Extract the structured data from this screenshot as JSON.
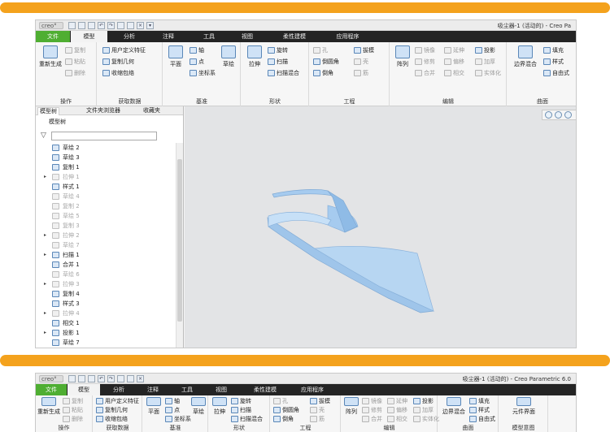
{
  "app": {
    "logo": "creo°",
    "window_title": "吸尘器-1 (活动的) - Creo Parametric 6.0",
    "window_title_truncated": "吸尘器-1 (活动的) - Creo Pa"
  },
  "tabs": [
    "文件",
    "模型",
    "分析",
    "注释",
    "工具",
    "视图",
    "柔性建模",
    "应用程序"
  ],
  "ribbon": {
    "operation": {
      "label": "操作",
      "regenerate": "重新生成",
      "copy": "复制",
      "paste": "粘贴",
      "delete": "删除"
    },
    "get_data": {
      "label": "获取数据",
      "user_feature": "用户定义特征",
      "copy_geometry": "复制几何",
      "shrinkwrap": "收缩包络"
    },
    "datum": {
      "label": "基准",
      "plane": "平面",
      "axis": "轴",
      "point": "点",
      "csys": "坐标系",
      "sketch": "草绘"
    },
    "shapes": {
      "label": "形状",
      "extrude": "拉伸",
      "revolve": "旋转",
      "sweep": "扫描",
      "swept_blend": "扫描混合"
    },
    "engineering": {
      "label": "工程",
      "hole": "孔",
      "round": "倒圆角",
      "chamfer": "倒角",
      "draft": "拔模",
      "shell": "壳",
      "rib": "筋"
    },
    "editing": {
      "label": "编辑",
      "pattern": "阵列",
      "mirror": "镜像",
      "trim": "修剪",
      "merge": "合并",
      "extend": "延伸",
      "offset": "偏移",
      "intersect": "相交",
      "project": "投影",
      "thicken": "加厚",
      "solidify": "实体化"
    },
    "surfaces": {
      "label": "曲面",
      "boundary_blend": "边界混合",
      "fill": "填充",
      "style": "样式",
      "freestyle": "自由式"
    },
    "model_intent": {
      "label": "模型意图",
      "element_interface": "元件界面"
    }
  },
  "panel": {
    "tabs": [
      "模型树",
      "文件夹浏览器",
      "收藏夹"
    ],
    "title": "模型树",
    "tree": [
      {
        "label": "草绘 2",
        "dim": false,
        "expand": false
      },
      {
        "label": "草绘 3",
        "dim": false,
        "expand": false
      },
      {
        "label": "复制 1",
        "dim": false,
        "expand": false
      },
      {
        "label": "拉伸 1",
        "dim": true,
        "expand": true
      },
      {
        "label": "样式 1",
        "dim": false,
        "expand": false
      },
      {
        "label": "草绘 4",
        "dim": true,
        "expand": false
      },
      {
        "label": "复制 2",
        "dim": true,
        "expand": false
      },
      {
        "label": "草绘 5",
        "dim": true,
        "expand": false
      },
      {
        "label": "复制 3",
        "dim": true,
        "expand": false
      },
      {
        "label": "拉伸 2",
        "dim": true,
        "expand": true
      },
      {
        "label": "草绘 7",
        "dim": true,
        "expand": false
      },
      {
        "label": "扫描 1",
        "dim": false,
        "expand": true
      },
      {
        "label": "合并 1",
        "dim": false,
        "expand": false
      },
      {
        "label": "草绘 6",
        "dim": true,
        "expand": false
      },
      {
        "label": "拉伸 3",
        "dim": true,
        "expand": true
      },
      {
        "label": "复制 4",
        "dim": false,
        "expand": false
      },
      {
        "label": "样式 3",
        "dim": false,
        "expand": false
      },
      {
        "label": "拉伸 4",
        "dim": true,
        "expand": true
      },
      {
        "label": "相交 1",
        "dim": false,
        "expand": false
      },
      {
        "label": "投影 1",
        "dim": false,
        "expand": true
      },
      {
        "label": "草绘 7",
        "dim": false,
        "expand": false
      },
      {
        "label": "样式 4",
        "dim": false,
        "expand": false
      },
      {
        "label": "拉伸 5",
        "dim": false,
        "expand": true
      }
    ]
  },
  "colors": {
    "accent_bar": "#f4a21d",
    "file_tab": "#4fae32",
    "model_fill": "#a9cdf0"
  }
}
